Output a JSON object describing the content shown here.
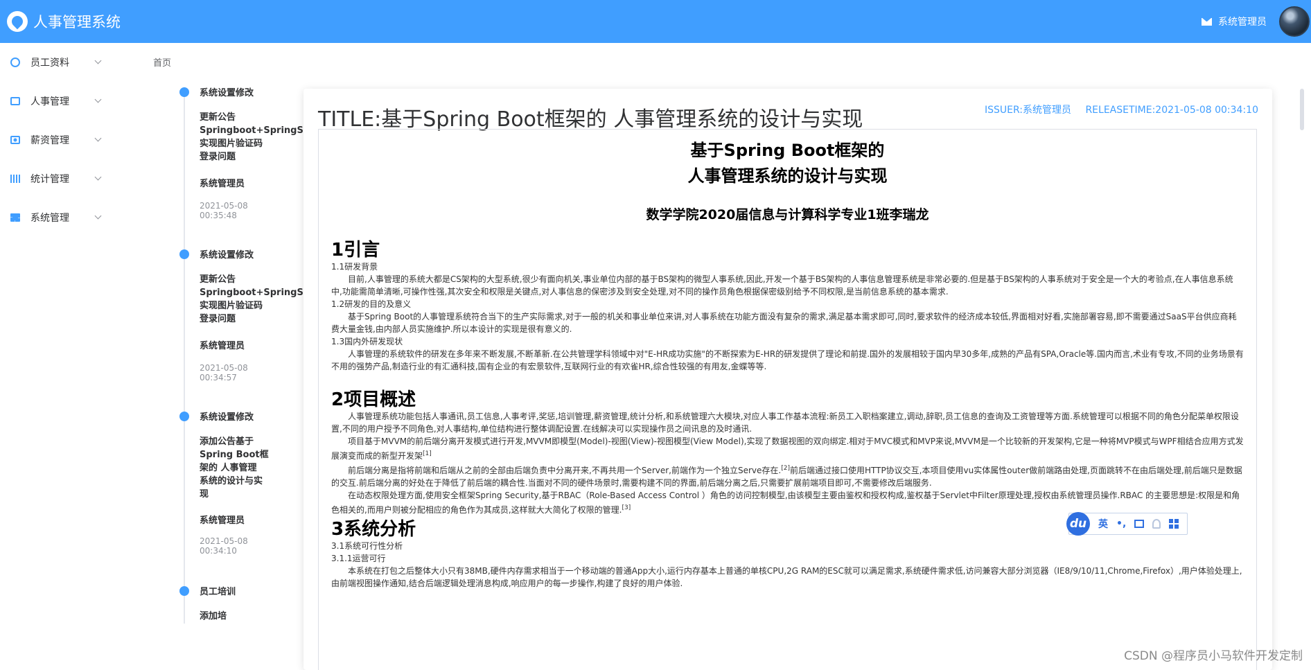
{
  "header": {
    "title": "人事管理系统",
    "user": "系统管理员"
  },
  "sidebar": {
    "items": [
      {
        "label": "员工资料",
        "icon": "user-icon"
      },
      {
        "label": "人事管理",
        "icon": "card-icon"
      },
      {
        "label": "薪资管理",
        "icon": "money-icon"
      },
      {
        "label": "统计管理",
        "icon": "chart-icon"
      },
      {
        "label": "系统管理",
        "icon": "windows-icon"
      }
    ]
  },
  "breadcrumb": "首页",
  "timeline": [
    {
      "head": "系统设置修改",
      "body": "更新公告\nSpringboot+SpringSe\n实现图片验证码\n登录问题",
      "who": "系统管理员",
      "time": "2021-05-08\n00:35:48"
    },
    {
      "head": "系统设置修改",
      "body": "更新公告\nSpringboot+SpringSe\n实现图片验证码\n登录问题",
      "who": "系统管理员",
      "time": "2021-05-08\n00:34:57"
    },
    {
      "head": "系统设置修改",
      "body": "添加公告基于\nSpring Boot框\n架的 人事管理\n系统的设计与实\n现",
      "who": "系统管理员",
      "time": "2021-05-08\n00:34:10"
    },
    {
      "head": "员工培训",
      "body": "添加培",
      "who": "",
      "time": ""
    }
  ],
  "article": {
    "title": "TITLE:基于Spring Boot框架的 人事管理系统的设计与实现",
    "issuer": "ISSUER:系统管理员",
    "releasetime": "RELEASETIME:2021-05-08 00:34:10",
    "doc_title": "基于Spring Boot框架的\n人事管理系统的设计与实现",
    "doc_subtitle": "数学学院2020届信息与计算科学专业1班李瑞龙",
    "s1_title": "1引言",
    "s1_1": "1.1研发背景",
    "s1_1_p": "目前,人事管理的系统大都是CS架构的大型系统,很少有面向机关,事业单位内部的基于BS架构的微型人事系统,因此,开发一个基于BS架构的人事信息管理系统是非常必要的.但是基于BS架构的人事系统对于安全是一个大的考验点,在人事信息系统中,功能需简单清晰,可操作性强,其次安全和权限是关键点,对人事信息的保密涉及到安全处理,对不同的操作员角色根据保密级别给予不同权限,是当前信息系统的基本需求.",
    "s1_2": "1.2研发的目的及意义",
    "s1_2_p": "基于Spring Boot的人事管理系统符合当下的生产实际需求,对于一般的机关和事业单位来讲,对人事系统在功能方面没有复杂的需求,满足基本需求即可,同时,要求软件的经济成本较低,界面相对好看,实施部署容易,即不需要通过SaaS平台供应商耗费大量金钱,由内部人员实施维护.所以本设计的实现是很有意义的.",
    "s1_3": "1.3国内外研发现状",
    "s1_3_p": "人事管理的系统软件的研发在多年来不断发展,不断革新.在公共管理学科领域中对\"E-HR成功实施\"的不断探索为E-HR的研发提供了理论和前提.国外的发展相较于国内早30多年,成熟的产品有SPA,Oracle等.国内而言,术业有专攻,不同的业务场景有不用的强势产品,制造行业的有汇通科技,国有企业的有宏景软件,互联网行业的有欢雀HR,综合性较强的有用友,金蝶等等.",
    "s2_title": "2项目概述",
    "s2_p1": "人事管理系统功能包括人事通讯,员工信息,人事考评,奖惩,培训管理,薪资管理,统计分析,和系统管理六大模块,对应人事工作基本流程:新员工入职档案建立,调动,辞职,员工信息的查询及工资管理等方面.系统管理可以根据不同的角色分配菜单权限设置,不同的用户授予不同角色,对人事结构,单位结构进行整体调配设置.在线解决可以实现操作员之间讯息的及时通讯.",
    "s2_p2": "项目基于MVVM的前后端分离开发模式进行开发,MVVM即模型(Model)-视图(View)-视图模型(View Model),实现了数据视图的双向绑定.相对于MVC模式和MVP来说,MVVM是一个比较新的开发架构,它是一种将MVP模式与WPF相结合应用方式发展演变而成的新型开发架",
    "s2_p2_ref": "[1]",
    "s2_p3a": "前后端分离是指将前端和后端从之前的全部由后端负责中分离开来,不再共用一个Server,前端作为一个独立Serve存在.",
    "s2_p3_ref": "[2]",
    "s2_p3b": "前后端通过接口使用HTTP协议交互,本项目使用vu实体属性outer做前端路由处理,页面跳转不在由后端处理,前后端只是数据的交互.前后端分离的好处在于降低了前后端的耦合性.当面对不同的硬件场景时,需要构建不同的界面,前后端分离之后,只需要扩展前端项目即可,不需要修改后端服务.",
    "s2_p4": "在动态权限处理方面,使用安全框架Spring Security,基于RBAC（Role-Based Access Control ）角色的访问控制模型,由该模型主要由鉴权和授权构成,鉴权基于Servlet中Filter原理处理,授权由系统管理员操作.RBAC 的主要思想是:权限是和角色相关的,而用户则被分配相应的角色作为其成员,这样就大大简化了权限的管理.",
    "s2_p4_ref": "[3]",
    "s3_title": "3系统分析",
    "s3_1": "3.1系统可行性分析",
    "s3_1_1": "3.1.1运营可行",
    "s3_1_1_p": "本系统在打包之后整体大小只有38MB,硬件内存需求相当于一个移动端的普通App大小,运行内存基本上普通的单核CPU,2G RAM的ESC就可以满足需求,系统硬件需求低,访问兼容大部分浏览器（IE8/9/10/11,Chrome,Firefox）,用户体验处理上,由前端视图操作通知,结合后端逻辑处理消息构成,响应用户的每一步操作,构建了良好的用户体验."
  },
  "ime": {
    "logo": "du",
    "lang": "英",
    "punct": "•,"
  },
  "watermark": "CSDN @程序员小马软件开发定制"
}
